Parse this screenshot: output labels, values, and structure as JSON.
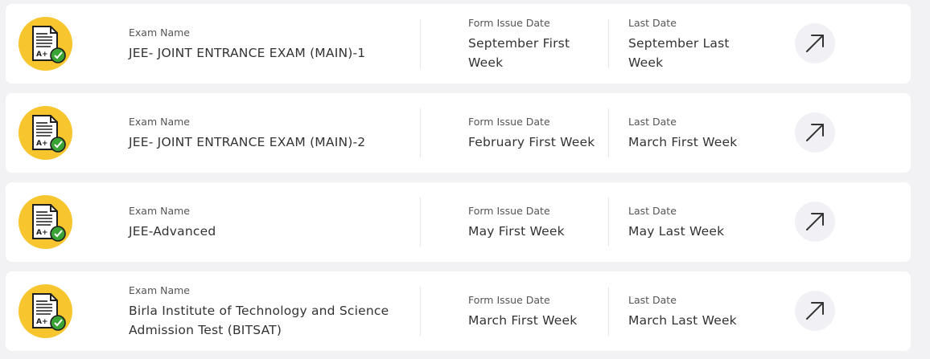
{
  "exams": [
    {
      "icon": "exam-sheet-check-icon",
      "name_label": "Exam Name",
      "name": "JEE- JOINT ENTRANCE EXAM (MAIN)-1",
      "issue_label": "Form Issue Date",
      "issue_date": "September First Week",
      "last_label": "Last Date",
      "last_date": "September Last Week",
      "action_icon": "arrow-up-right-icon"
    },
    {
      "icon": "exam-sheet-check-icon",
      "name_label": "Exam Name",
      "name": "JEE- JOINT ENTRANCE EXAM (MAIN)-2",
      "issue_label": "Form Issue Date",
      "issue_date": "February First Week",
      "last_label": "Last Date",
      "last_date": "March First Week",
      "action_icon": "arrow-up-right-icon"
    },
    {
      "icon": "exam-sheet-check-icon",
      "name_label": "Exam Name",
      "name": "JEE-Advanced",
      "issue_label": "Form Issue Date",
      "issue_date": "May First Week",
      "last_label": "Last Date",
      "last_date": "May Last Week",
      "action_icon": "arrow-up-right-icon"
    },
    {
      "icon": "exam-sheet-check-icon",
      "name_label": "Exam Name",
      "name": "Birla Institute of Technology and Science Admission Test (BITSAT)",
      "issue_label": "Form Issue Date",
      "issue_date": "March First Week",
      "last_label": "Last Date",
      "last_date": "March Last Week",
      "action_icon": "arrow-up-right-icon"
    }
  ],
  "icon_sheet_text": "A+",
  "colors": {
    "page_bg": "#f2f2f5",
    "card_bg": "#ffffff",
    "icon_circle": "#f7c52e",
    "check_green": "#3aa335",
    "arrow_button_bg": "#f1f1f5"
  }
}
